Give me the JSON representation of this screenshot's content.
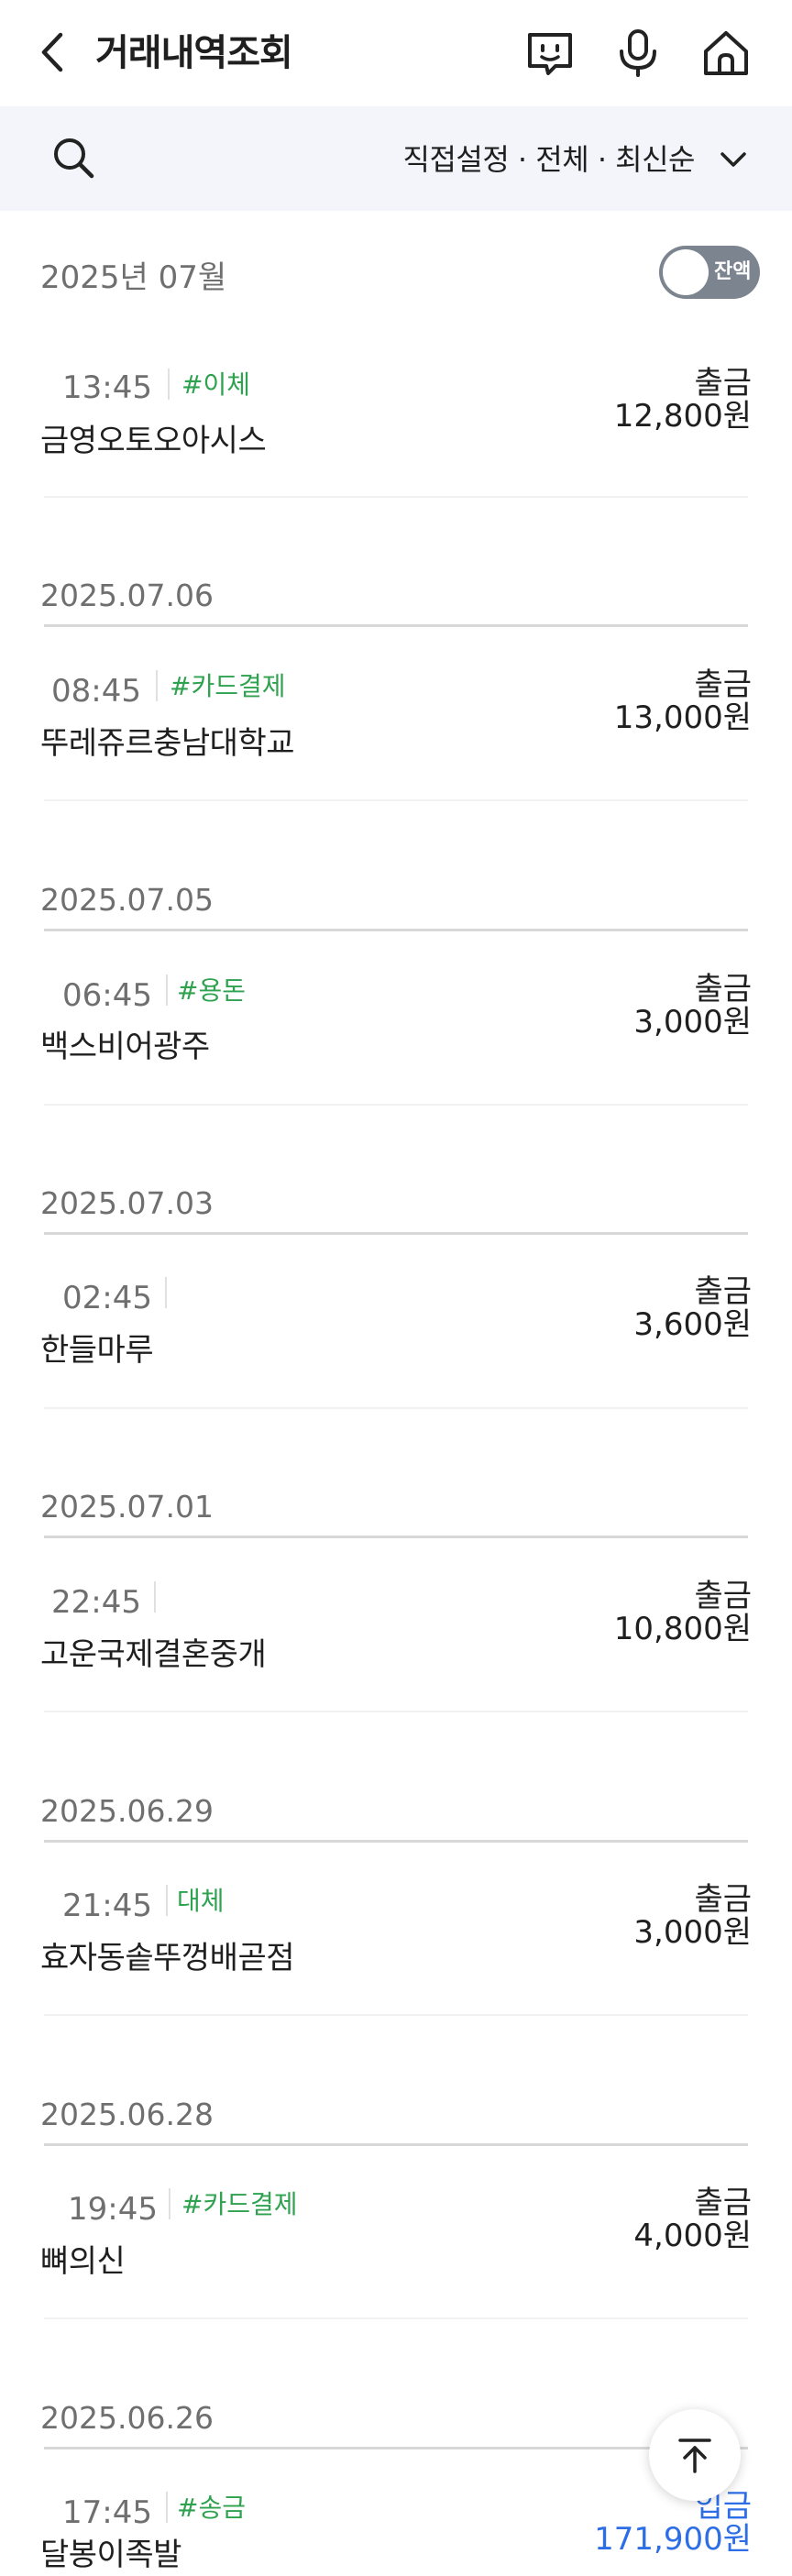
{
  "header": {
    "title": "거래내역조회",
    "icons": [
      "back-arrow-icon",
      "chatbot-icon",
      "microphone-icon",
      "home-icon"
    ]
  },
  "filter": {
    "summary": "직접설정 · 전체 · 최신순"
  },
  "month": {
    "label": "2025년 07월",
    "balance_toggle_label": "잔액"
  },
  "groups": [
    {
      "date": "",
      "transactions": [
        {
          "time": "13:45",
          "tag": "#이체",
          "merchant": "금영오토오아시스",
          "type": "출금",
          "amount": "12,800원"
        }
      ]
    },
    {
      "date": "2025.07.06",
      "transactions": [
        {
          "time": "08:45",
          "tag": "#카드결제",
          "merchant": "뚜레쥬르충남대학교",
          "type": "출금",
          "amount": "13,000원"
        }
      ]
    },
    {
      "date": "2025.07.05",
      "transactions": [
        {
          "time": "06:45",
          "tag": "#용돈",
          "merchant": "백스비어광주",
          "type": "출금",
          "amount": "3,000원"
        }
      ]
    },
    {
      "date": "2025.07.03",
      "transactions": [
        {
          "time": "02:45",
          "tag": "",
          "merchant": "한들마루",
          "type": "출금",
          "amount": "3,600원"
        }
      ]
    },
    {
      "date": "2025.07.01",
      "transactions": [
        {
          "time": "22:45",
          "tag": "",
          "merchant": "고운국제결혼중개",
          "type": "출금",
          "amount": "10,800원"
        }
      ]
    },
    {
      "date": "2025.06.29",
      "transactions": [
        {
          "time": "21:45",
          "tag": "대체",
          "merchant": "효자동솥뚜껑배곧점",
          "type": "출금",
          "amount": "3,000원"
        }
      ]
    },
    {
      "date": "2025.06.28",
      "transactions": [
        {
          "time": "19:45",
          "tag": "#카드결제",
          "merchant": "뼈의신",
          "type": "출금",
          "amount": "4,000원"
        }
      ]
    },
    {
      "date": "2025.06.26",
      "transactions": [
        {
          "time": "17:45",
          "tag": "#송금",
          "merchant": "달봉이족발",
          "type": "입금",
          "amount": "171,900원"
        }
      ]
    }
  ],
  "colors": {
    "tag_green": "#2fa24f",
    "deposit_blue": "#2d6ee6",
    "filter_bg": "#f3f5fa",
    "toggle_bg": "#7c8490"
  }
}
